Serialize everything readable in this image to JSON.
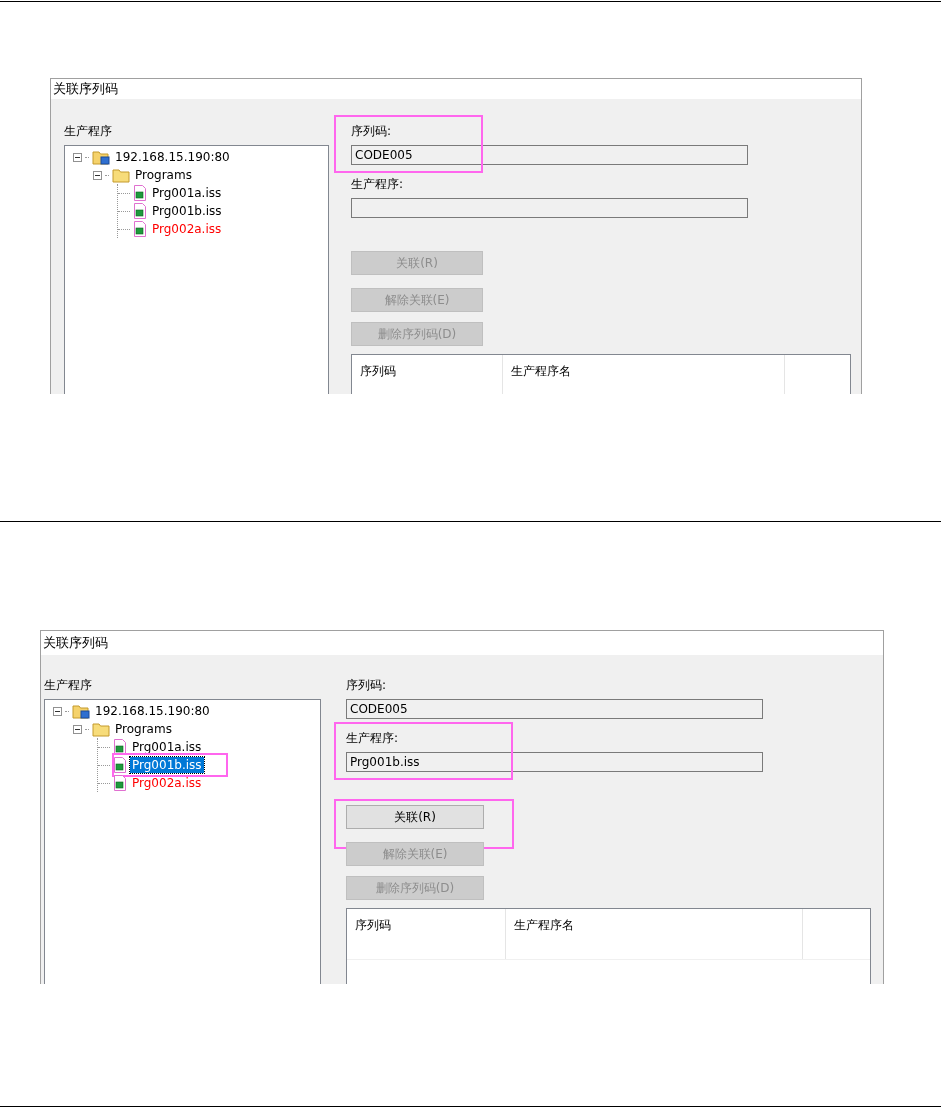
{
  "screens": [
    {
      "window": {
        "title": "关联序列码"
      },
      "tree": {
        "label": "生产程序",
        "items": [
          {
            "label": "192.168.15.190:80",
            "kind": "server",
            "expanded": true,
            "selected": false,
            "highlighted": false,
            "children": [
              {
                "label": "Programs",
                "kind": "folder",
                "expanded": true,
                "selected": false,
                "highlighted": false,
                "children": [
                  {
                    "label": "Prg001a.iss",
                    "kind": "file",
                    "selected": false,
                    "highlighted": false,
                    "color": "#000000"
                  },
                  {
                    "label": "Prg001b.iss",
                    "kind": "file",
                    "selected": false,
                    "highlighted": false,
                    "color": "#000000"
                  },
                  {
                    "label": "Prg002a.iss",
                    "kind": "file",
                    "selected": false,
                    "highlighted": false,
                    "color": "#ff0000"
                  }
                ]
              }
            ]
          }
        ]
      },
      "fields": [
        {
          "label": "序列码:",
          "value": "CODE005",
          "highlighted": true
        },
        {
          "label": "生产程序:",
          "highlighted": false
        }
      ],
      "buttons": [
        {
          "label": "关联(R)",
          "disabled": true,
          "highlighted": false
        },
        {
          "label": "解除关联(E)",
          "disabled": true,
          "highlighted": false
        },
        {
          "label": "删除序列码(D)",
          "disabled": true,
          "highlighted": false
        }
      ],
      "table": {
        "columns": [
          "序列码",
          "生产程序名"
        ]
      }
    },
    {
      "window": {
        "title": "关联序列码"
      },
      "tree": {
        "label": "生产程序",
        "items": [
          {
            "label": "192.168.15.190:80",
            "kind": "server",
            "expanded": true,
            "selected": false,
            "highlighted": false,
            "children": [
              {
                "label": "Programs",
                "kind": "folder",
                "expanded": true,
                "selected": false,
                "highlighted": false,
                "children": [
                  {
                    "label": "Prg001a.iss",
                    "kind": "file",
                    "selected": false,
                    "highlighted": false,
                    "color": "#000000"
                  },
                  {
                    "label": "Prg001b.iss",
                    "kind": "file",
                    "selected": true,
                    "highlighted": true
                  },
                  {
                    "label": "Prg002a.iss",
                    "kind": "file",
                    "selected": false,
                    "highlighted": false,
                    "color": "#ff0000"
                  }
                ]
              }
            ]
          }
        ]
      },
      "fields": [
        {
          "label": "序列码:",
          "value": "CODE005",
          "highlighted": false
        },
        {
          "label": "生产程序:",
          "value": "Prg001b.iss",
          "highlighted": true
        }
      ],
      "buttons": [
        {
          "label": "关联(R)",
          "disabled": false,
          "highlighted": true
        },
        {
          "label": "解除关联(E)",
          "disabled": true,
          "highlighted": false
        },
        {
          "label": "删除序列码(D)",
          "disabled": true,
          "highlighted": false
        }
      ],
      "table": {
        "columns": [
          "序列码",
          "生产程序名"
        ]
      }
    }
  ]
}
